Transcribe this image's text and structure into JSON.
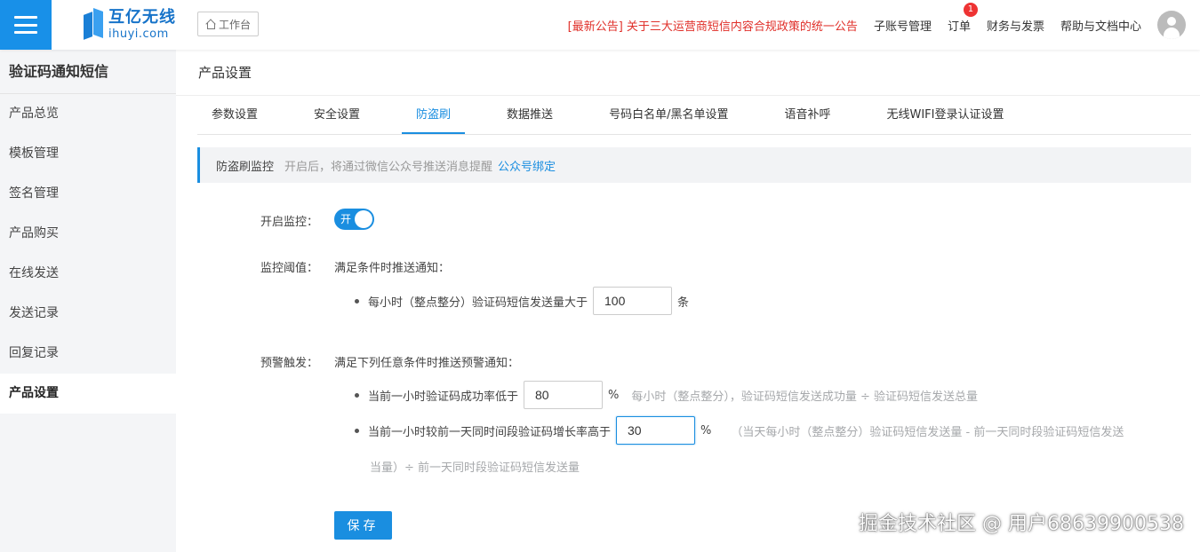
{
  "brand": {
    "cn": "互亿无线",
    "en": "ihuyi.com"
  },
  "header": {
    "workbench_label": "工作台",
    "notice": "[最新公告] 关于三大运营商短信内容合规政策的统一公告",
    "links": [
      "子账号管理",
      "订单",
      "财务与发票",
      "帮助与文档中心"
    ],
    "order_badge": "1"
  },
  "sidebar": {
    "title": "验证码通知短信",
    "items": [
      {
        "label": "产品总览"
      },
      {
        "label": "模板管理"
      },
      {
        "label": "签名管理"
      },
      {
        "label": "产品购买"
      },
      {
        "label": "在线发送"
      },
      {
        "label": "发送记录"
      },
      {
        "label": "回复记录"
      },
      {
        "label": "产品设置"
      }
    ],
    "active_index": 7
  },
  "main": {
    "title": "产品设置",
    "tabs": [
      {
        "label": "参数设置"
      },
      {
        "label": "安全设置"
      },
      {
        "label": "防盗刷"
      },
      {
        "label": "数据推送"
      },
      {
        "label": "号码白名单/黑名单设置"
      },
      {
        "label": "语音补呼"
      },
      {
        "label": "无线WIFI登录认证设置"
      }
    ],
    "active_tab": 2,
    "alert": {
      "title": "防盗刷监控",
      "desc": "开启后，将通过微信公众号推送消息提醒",
      "link": "公众号绑定"
    },
    "monitor": {
      "label": "开启监控：",
      "toggle_text": "开",
      "enabled": true
    },
    "threshold": {
      "label": "监控阈值：",
      "intro": "满足条件时推送通知：",
      "row_text": "每小时（整点整分）验证码短信发送量大于",
      "value": "100",
      "unit": "条"
    },
    "warning": {
      "label": "预警触发：",
      "intro": "满足下列任意条件时推送预警通知：",
      "row1_text": "当前一小时验证码成功率低于",
      "row1_value": "80",
      "row1_unit": "%",
      "row1_hint": "每小时（整点整分），验证码短信发送成功量 ÷ 验证码短信发送总量",
      "row2_text": "当前一小时较前一天同时间段验证码增长率高于",
      "row2_value": "30",
      "row2_unit": "%",
      "row2_hint": "（当天每小时（整点整分）验证码短信发送量 - 前一天同时段验证码短信发送",
      "row2_hint_cont": "当量）÷ 前一天同时段验证码短信发送量"
    },
    "save_label": "保存"
  },
  "watermark": "掘金技术社区 @ 用户68639900538"
}
